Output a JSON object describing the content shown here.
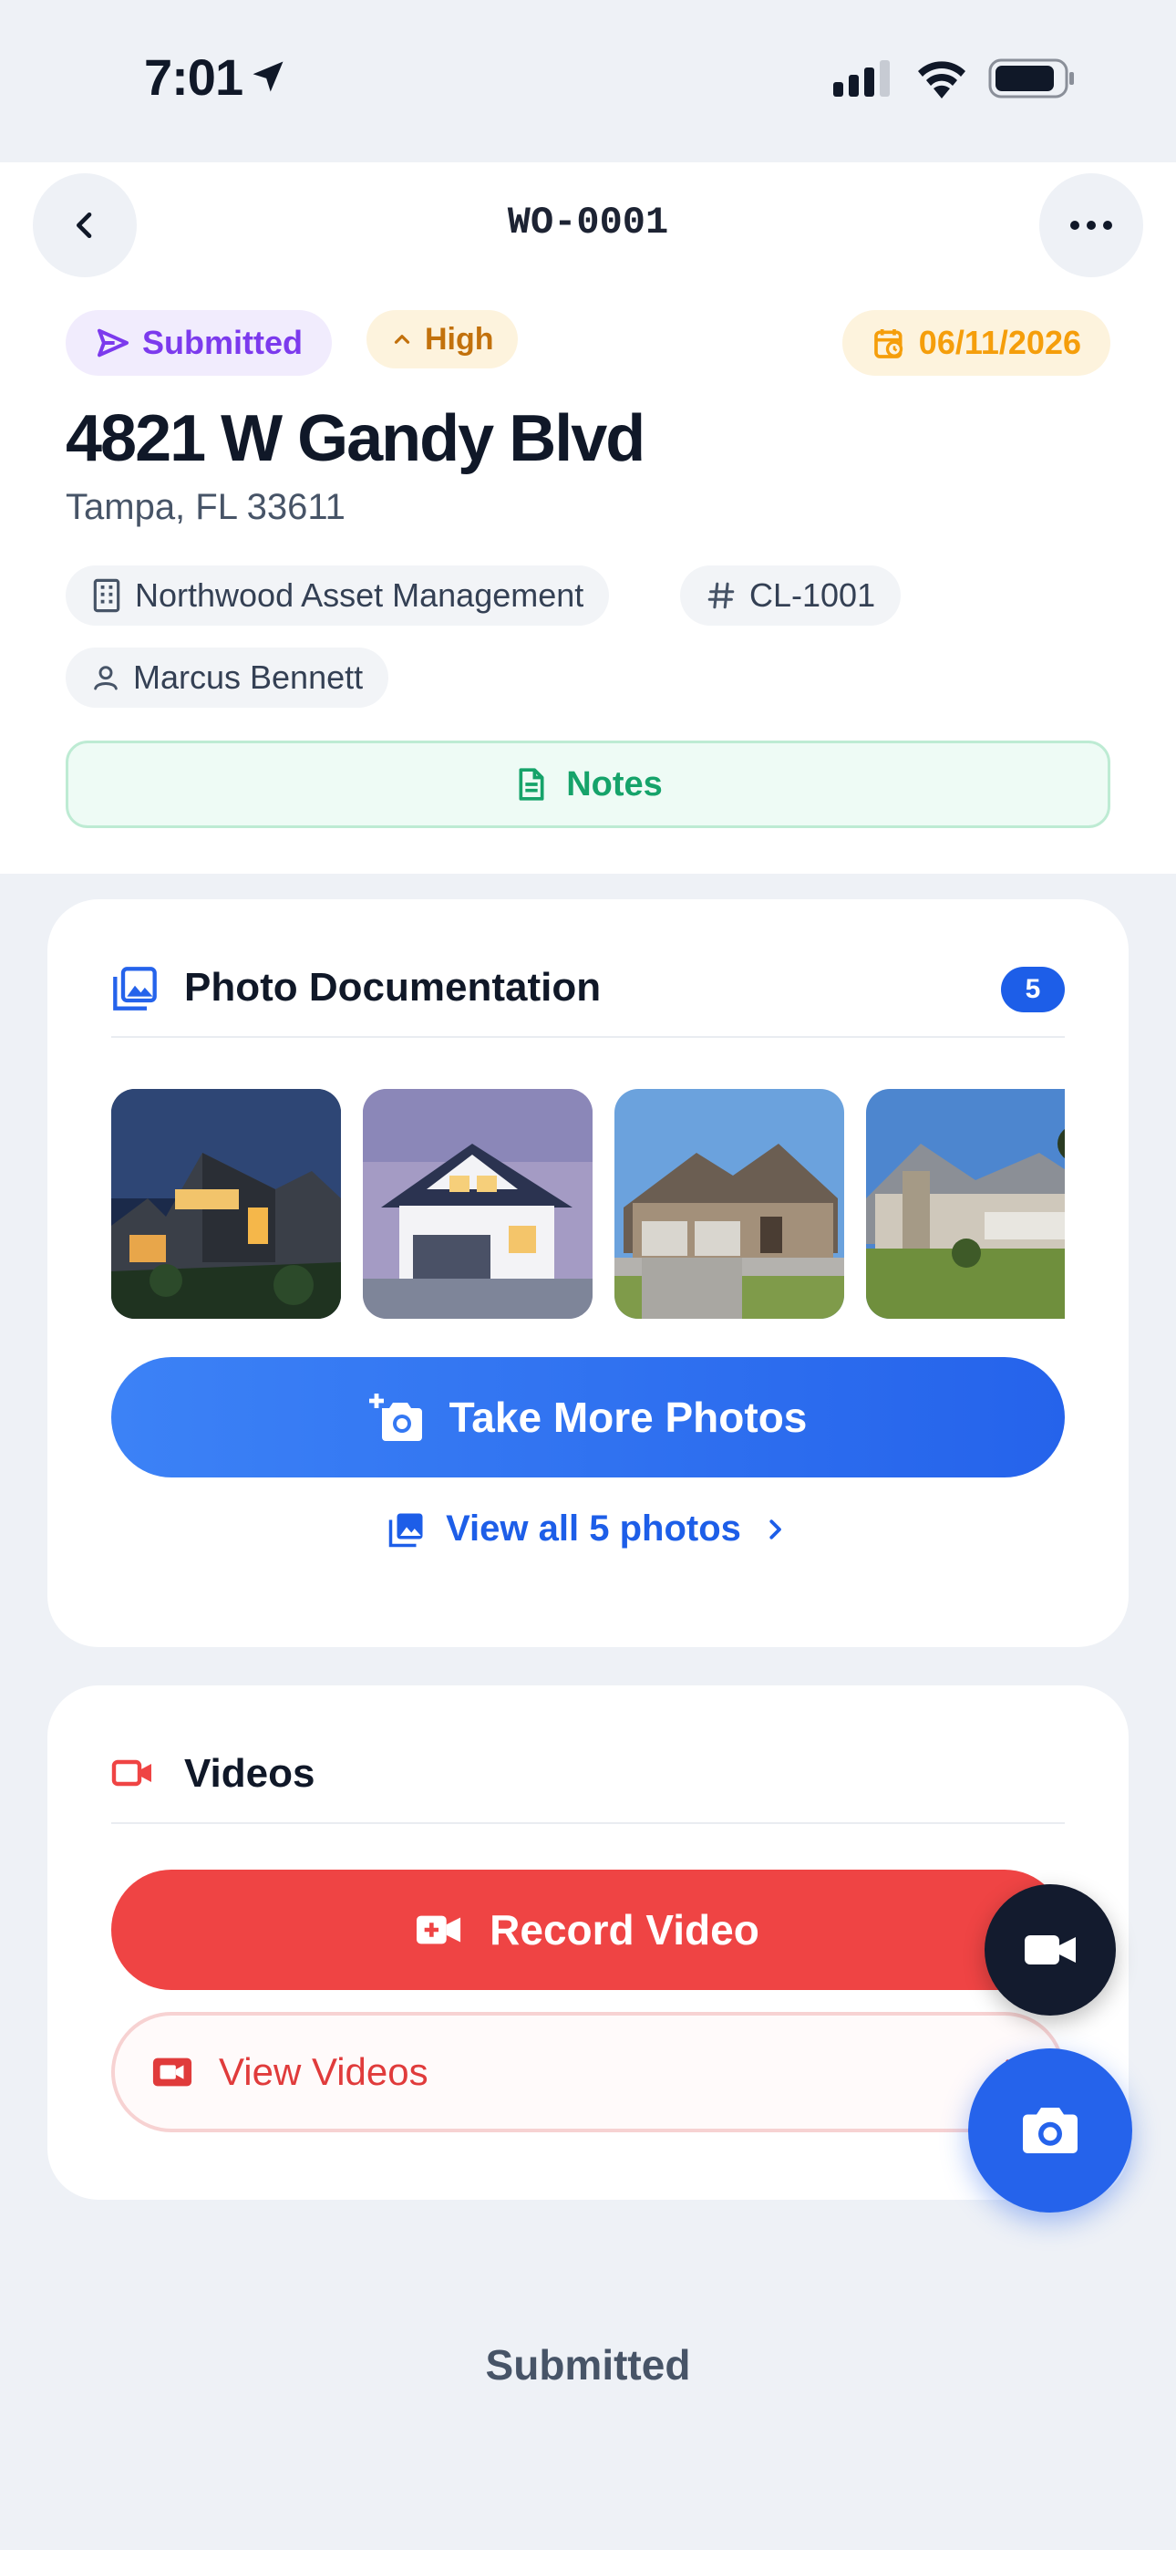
{
  "status_bar": {
    "time": "7:01"
  },
  "header": {
    "work_order_id": "WO-0001",
    "status": "Submitted",
    "priority": "High",
    "due_date": "06/11/2026",
    "address": "4821 W Gandy Blvd",
    "city_state_zip": "Tampa, FL 33611",
    "company": "Northwood Asset Management",
    "client_id": "CL-1001",
    "assignee": "Marcus Bennett",
    "notes_label": "Notes"
  },
  "photos": {
    "title": "Photo Documentation",
    "count": "5",
    "take_more_label": "Take More Photos",
    "view_all_label": "View all 5 photos"
  },
  "videos": {
    "title": "Videos",
    "record_label": "Record Video",
    "view_label": "View Videos"
  },
  "footer": {
    "status": "Submitted"
  },
  "colors": {
    "accent_blue": "#2563eb",
    "status_purple": "#7c3aed",
    "priority_orange": "#c2710c",
    "date_amber": "#f59e0b",
    "notes_green": "#16a36a",
    "video_red": "#ef4444"
  }
}
